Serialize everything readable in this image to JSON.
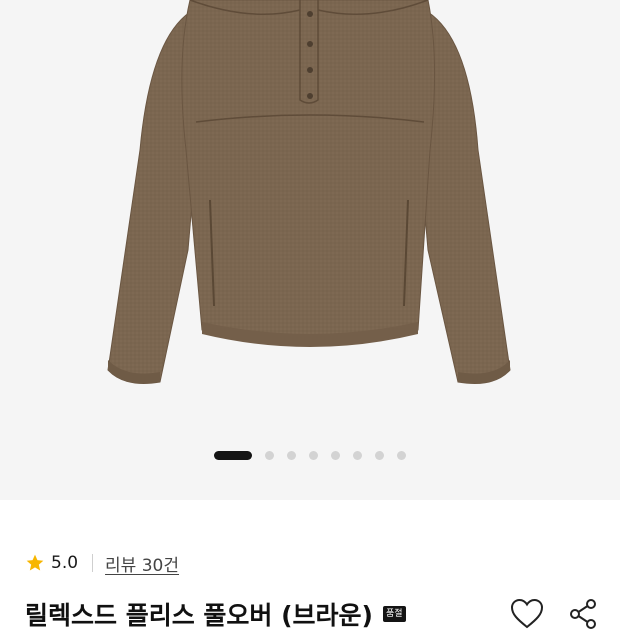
{
  "gallery": {
    "image_subject": "brown fleece half-snap pullover",
    "page_count": 8,
    "active_page": 1
  },
  "rating": {
    "icon": "star-icon",
    "value": "5.0",
    "review_label": "리뷰 30건",
    "star_color": "#f7b600"
  },
  "product": {
    "title": "릴렉스드 플리스 풀오버 (브라운)",
    "badge": "품절"
  },
  "actions": {
    "wishlist_icon": "heart-icon",
    "share_icon": "share-icon"
  },
  "colors": {
    "garment": "#7b6650",
    "background": "#f5f5f5",
    "active_dot": "#141414",
    "inactive_dot": "#d3d3d3"
  }
}
